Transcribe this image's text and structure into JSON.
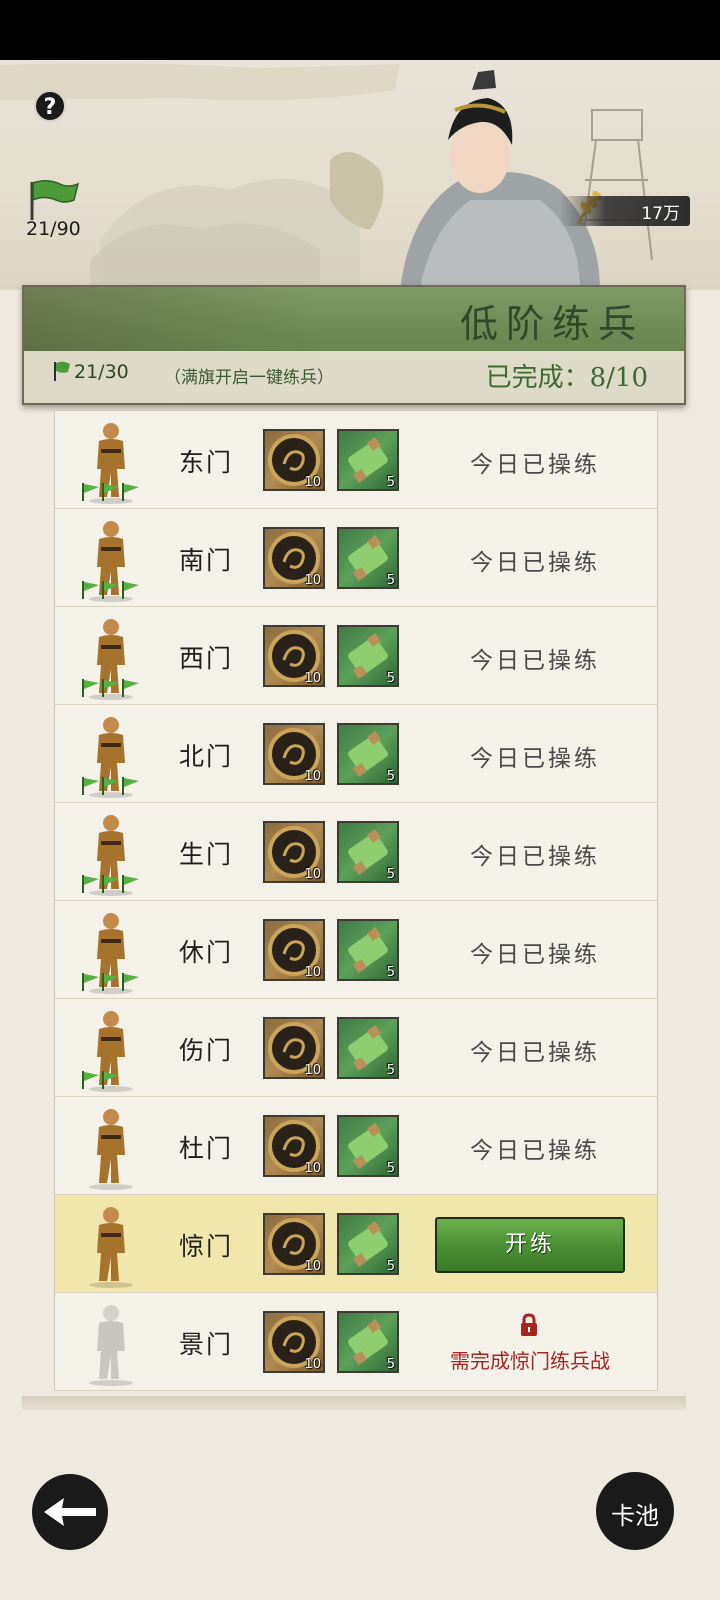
{
  "header": {
    "help_label": "?",
    "flag_count": "21/90",
    "power_value": "17万"
  },
  "banner": {
    "title": "低阶练兵",
    "flag_progress": "21/30",
    "hint": "（满旗开启一键练兵）",
    "completed": "已完成：8/10"
  },
  "rows": [
    {
      "gate": "东门",
      "coin_count": "10",
      "scroll_count": "5",
      "status": "今日已操练",
      "flags": 3
    },
    {
      "gate": "南门",
      "coin_count": "10",
      "scroll_count": "5",
      "status": "今日已操练",
      "flags": 3
    },
    {
      "gate": "西门",
      "coin_count": "10",
      "scroll_count": "5",
      "status": "今日已操练",
      "flags": 3
    },
    {
      "gate": "北门",
      "coin_count": "10",
      "scroll_count": "5",
      "status": "今日已操练",
      "flags": 3
    },
    {
      "gate": "生门",
      "coin_count": "10",
      "scroll_count": "5",
      "status": "今日已操练",
      "flags": 3
    },
    {
      "gate": "休门",
      "coin_count": "10",
      "scroll_count": "5",
      "status": "今日已操练",
      "flags": 3
    },
    {
      "gate": "伤门",
      "coin_count": "10",
      "scroll_count": "5",
      "status": "今日已操练",
      "flags": 2
    },
    {
      "gate": "杜门",
      "coin_count": "10",
      "scroll_count": "5",
      "status": "今日已操练",
      "flags": 0
    },
    {
      "gate": "惊门",
      "coin_count": "10",
      "scroll_count": "5",
      "button": "开练",
      "flags": 0
    },
    {
      "gate": "景门",
      "coin_count": "10",
      "scroll_count": "5",
      "locked_text": "需完成惊门练兵战",
      "flags": 0
    }
  ],
  "footer": {
    "pool_label": "卡池"
  },
  "colors": {
    "accent_green": "#4a8e34",
    "locked_red": "#a52620",
    "active_row": "#f1e7ac"
  }
}
